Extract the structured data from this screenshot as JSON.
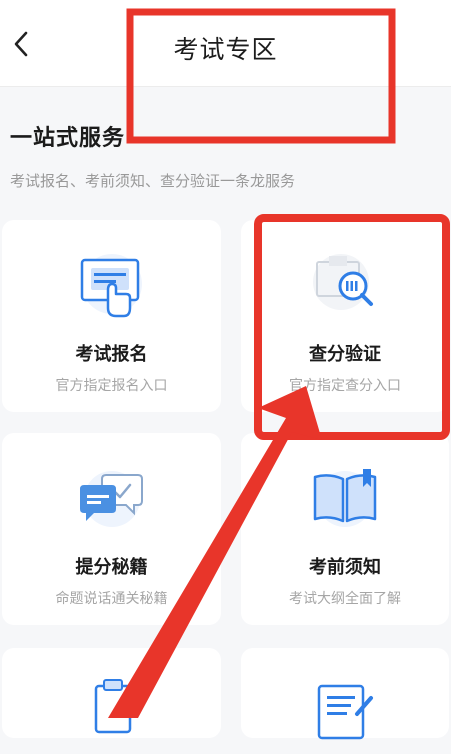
{
  "header": {
    "title": "考试专区"
  },
  "section": {
    "title": "一站式服务",
    "subtitle": "考试报名、考前须知、查分验证一条龙服务"
  },
  "cards": [
    {
      "name": "考试报名",
      "desc": "官方指定报名入口",
      "icon": "registration-icon"
    },
    {
      "name": "查分验证",
      "desc": "官方指定查分入口",
      "icon": "score-check-icon"
    },
    {
      "name": "提分秘籍",
      "desc": "命题说话通关秘籍",
      "icon": "chat-tips-icon"
    },
    {
      "name": "考前须知",
      "desc": "考试大纲全面了解",
      "icon": "book-icon"
    }
  ],
  "colors": {
    "accent": "#2f7ee6",
    "annotation": "#e8352a"
  }
}
